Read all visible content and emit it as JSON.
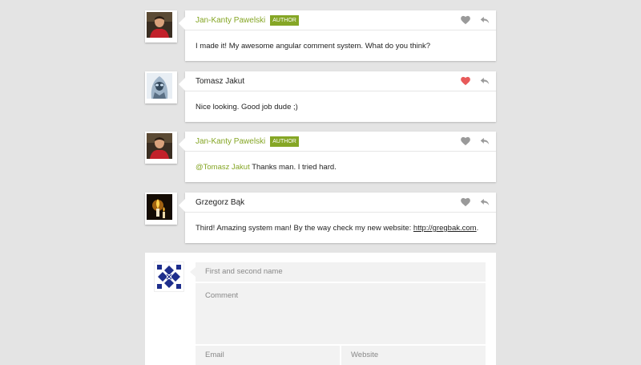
{
  "comments": [
    {
      "author": "Jan-Kanty Pawelski",
      "badge": "AUTHOR",
      "is_author": true,
      "liked": false,
      "text": "I made it! My awesome angular comment system. What do you think?"
    },
    {
      "author": "Tomasz Jakut",
      "badge": "",
      "is_author": false,
      "liked": true,
      "text": "Nice looking. Good job dude ;)"
    },
    {
      "author": "Jan-Kanty Pawelski",
      "badge": "AUTHOR",
      "is_author": true,
      "liked": false,
      "mention": "@Tomasz Jakut",
      "text": " Thanks man. I tried hard."
    },
    {
      "author": "Grzegorz Bąk",
      "badge": "",
      "is_author": false,
      "liked": false,
      "text": "Third! Amazing system man! By the way check my new website: ",
      "link": "http://gregbak.com",
      "text_after": "."
    }
  ],
  "form": {
    "name_placeholder": "First and second name",
    "comment_placeholder": "Comment",
    "email_placeholder": "Email",
    "website_placeholder": "Website"
  },
  "colors": {
    "accent": "#85a625",
    "liked": "#e85a5a",
    "icon": "#999999",
    "background": "#e4e4e4"
  },
  "icons": {
    "like": "heart-icon",
    "reply": "reply-icon"
  }
}
